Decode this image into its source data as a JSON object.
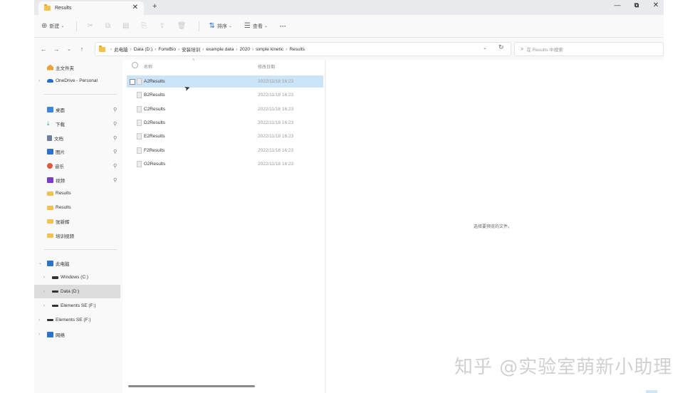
{
  "titlebar": {
    "tab_title": "Results",
    "close_glyph": "✕",
    "new_tab_glyph": "+",
    "minimize_glyph": "—",
    "maximize_glyph": "⧉",
    "window_close_glyph": "✕"
  },
  "commandbar": {
    "new_label": "新建",
    "sort_label": "排序",
    "view_label": "查看",
    "more_label": "···"
  },
  "address": {
    "crumbs": [
      "此电脑",
      "Data (D:)",
      "ForteBio",
      "安装培训",
      "example data",
      "2020",
      "simple kinetic",
      "Results"
    ],
    "search_placeholder": "在 Results 中搜索"
  },
  "sidebar": {
    "items": [
      {
        "label": "主文件夹",
        "icon": "home-icon",
        "color": "#e8a23a"
      },
      {
        "label": "OneDrive - Personal",
        "icon": "cloud-icon",
        "color": "#1e6fd0"
      },
      {
        "label": "桌面",
        "icon": "desktop-icon",
        "color": "#3a86d8"
      },
      {
        "label": "下载",
        "icon": "download-icon",
        "color": "#2aa86a"
      },
      {
        "label": "文档",
        "icon": "document-icon",
        "color": "#6a7fa0"
      },
      {
        "label": "图片",
        "icon": "pictures-icon",
        "color": "#2b72c9"
      },
      {
        "label": "音乐",
        "icon": "music-icon",
        "color": "#e0573a"
      },
      {
        "label": "视频",
        "icon": "video-icon",
        "color": "#7a3bc9"
      },
      {
        "label": "Results",
        "icon": "folder-icon",
        "color": "#f2c14e"
      },
      {
        "label": "Results",
        "icon": "folder-icon",
        "color": "#f2c14e"
      },
      {
        "label": "张新辉",
        "icon": "folder-icon",
        "color": "#f2c14e"
      },
      {
        "label": "培训视频",
        "icon": "folder-icon",
        "color": "#f2c14e"
      },
      {
        "label": "此电脑",
        "icon": "computer-icon",
        "color": "#2b72c9"
      },
      {
        "label": "Windows (C:)",
        "icon": "drive-icon",
        "color": "#333333"
      },
      {
        "label": "Data (D:)",
        "icon": "drive-icon",
        "color": "#333333"
      },
      {
        "label": "Elements SE (F:)",
        "icon": "drive-icon",
        "color": "#333333"
      },
      {
        "label": "Elements SE (F:)",
        "icon": "drive-icon",
        "color": "#333333"
      },
      {
        "label": "网络",
        "icon": "network-icon",
        "color": "#2b72c9"
      }
    ]
  },
  "filelist": {
    "col_name": "名称",
    "col_date": "修改日期",
    "rows": [
      {
        "name": "A2Results",
        "date": "2022/11/18 16:23"
      },
      {
        "name": "B2Results",
        "date": "2022/11/18 16:23"
      },
      {
        "name": "C2Results",
        "date": "2022/11/18 16:23"
      },
      {
        "name": "D2Results",
        "date": "2022/11/18 16:23"
      },
      {
        "name": "E2Results",
        "date": "2022/11/18 16:23"
      },
      {
        "name": "F2Results",
        "date": "2022/11/18 16:23"
      },
      {
        "name": "G2Results",
        "date": "2022/11/18 16:23"
      }
    ]
  },
  "preview": {
    "message": "选择要预览的文件。"
  },
  "watermark": "知乎 @实验室萌新小助理"
}
